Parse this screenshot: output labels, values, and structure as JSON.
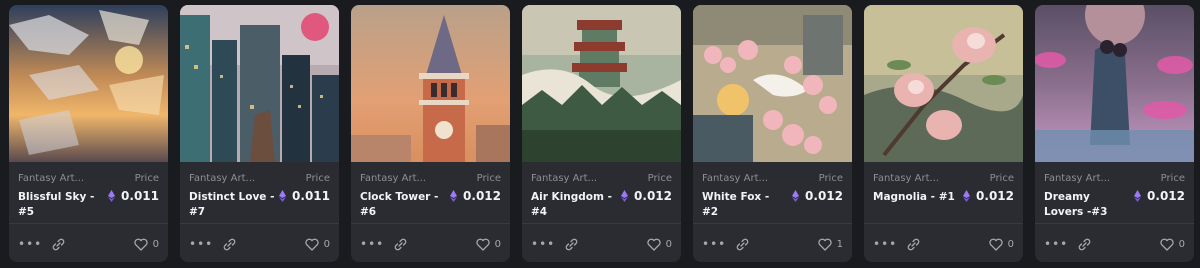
{
  "cards": [
    {
      "collection": "Fantasy Art...",
      "name": "Blissful Sky - #5",
      "price_label": "Price",
      "price": "0.011",
      "likes": "0",
      "art": "sky",
      "currency_icon": "ethereum-icon"
    },
    {
      "collection": "Fantasy Art...",
      "name": "Distinct Love - #7",
      "price_label": "Price",
      "price": "0.011",
      "likes": "0",
      "art": "city",
      "currency_icon": "ethereum-icon"
    },
    {
      "collection": "Fantasy Art...",
      "name": "Clock Tower - #6",
      "price_label": "Price",
      "price": "0.012",
      "likes": "0",
      "art": "tower",
      "currency_icon": "ethereum-icon"
    },
    {
      "collection": "Fantasy Art...",
      "name": "Air Kingdom - #4",
      "price_label": "Price",
      "price": "0.012",
      "likes": "0",
      "art": "pagoda",
      "currency_icon": "ethereum-icon"
    },
    {
      "collection": "Fantasy Art...",
      "name": "White Fox - #2",
      "price_label": "Price",
      "price": "0.012",
      "likes": "1",
      "art": "fox",
      "currency_icon": "ethereum-icon"
    },
    {
      "collection": "Fantasy Art...",
      "name": "Magnolia - #1",
      "price_label": "Price",
      "price": "0.012",
      "likes": "0",
      "art": "magnolia",
      "currency_icon": "ethereum-icon"
    },
    {
      "collection": "Fantasy Art...",
      "name": "Dreamy Lovers -#3",
      "price_label": "Price",
      "price": "0.012",
      "likes": "0",
      "art": "lovers",
      "currency_icon": "ethereum-icon"
    }
  ],
  "icons": {
    "more": "more-dots-icon",
    "share": "link-icon",
    "like": "heart-icon"
  },
  "colors": {
    "background": "#1a1b1e",
    "card": "#2b2c31",
    "accent": "#8f6cf0",
    "muted_text": "#8d8e94"
  }
}
